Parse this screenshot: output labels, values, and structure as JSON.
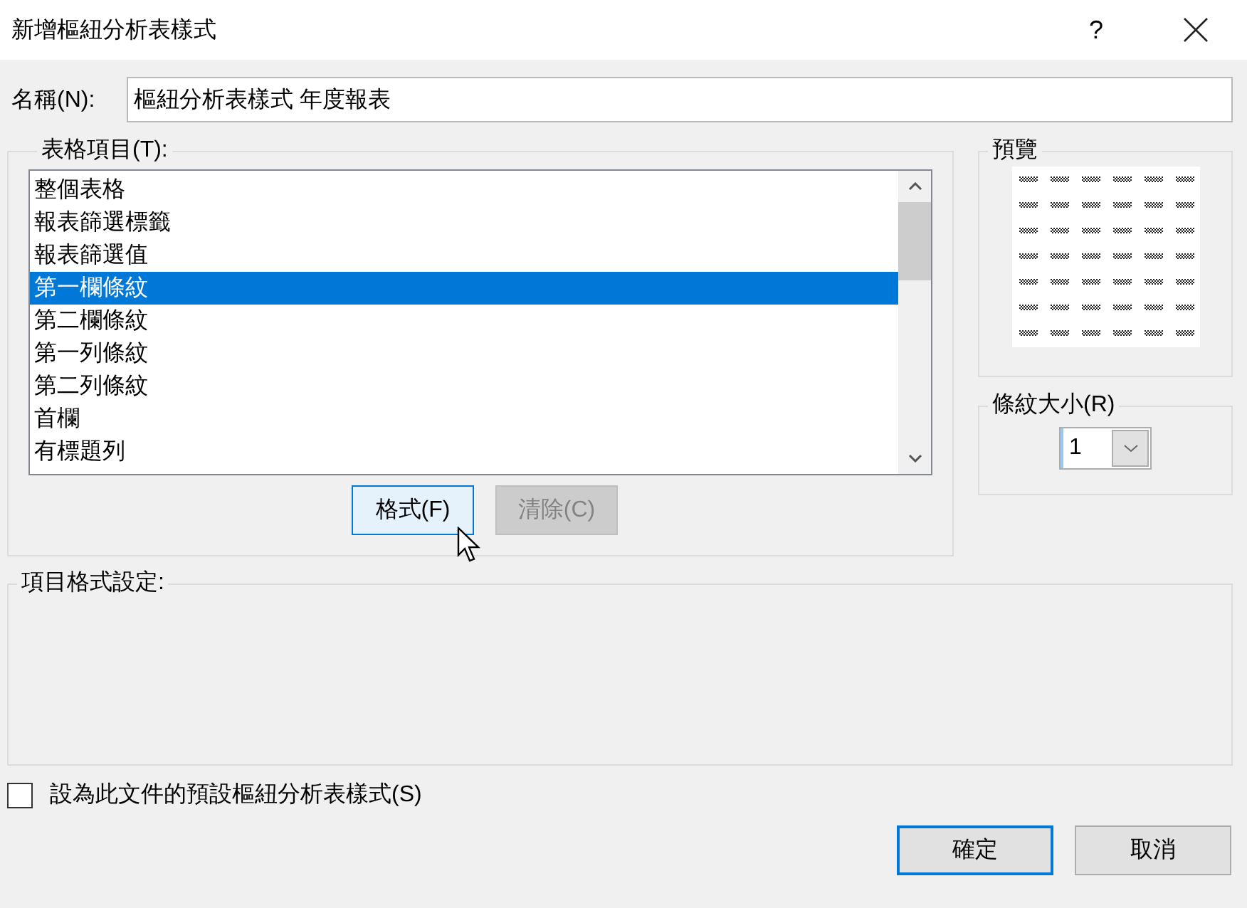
{
  "window": {
    "title": "新增樞紐分析表樣式",
    "help": "?"
  },
  "name_field": {
    "label": "名稱(N):",
    "value": "樞紐分析表樣式 年度報表"
  },
  "table_elements": {
    "label": "表格項目(T):",
    "items": [
      {
        "label": "整個表格",
        "selected": false
      },
      {
        "label": "報表篩選標籤",
        "selected": false
      },
      {
        "label": "報表篩選值",
        "selected": false
      },
      {
        "label": "第一欄條紋",
        "selected": true
      },
      {
        "label": "第二欄條紋",
        "selected": false
      },
      {
        "label": "第一列條紋",
        "selected": false
      },
      {
        "label": "第二列條紋",
        "selected": false
      },
      {
        "label": "首欄",
        "selected": false
      },
      {
        "label": "有標題列",
        "selected": false
      }
    ],
    "buttons": [
      {
        "label": "格式(F)",
        "disabled": false,
        "hovered": true
      },
      {
        "label": "清除(C)",
        "disabled": true,
        "hovered": false
      }
    ]
  },
  "preview": {
    "label": "預覽"
  },
  "stripe_size": {
    "label": "條紋大小(R)",
    "value": "1"
  },
  "element_formatting": {
    "label": "項目格式設定:"
  },
  "default_checkbox": {
    "label": "設為此文件的預設樞紐分析表樣式(S)",
    "checked": false
  },
  "buttons": [
    {
      "label": "確定",
      "default": true
    },
    {
      "label": "取消",
      "default": false
    }
  ]
}
